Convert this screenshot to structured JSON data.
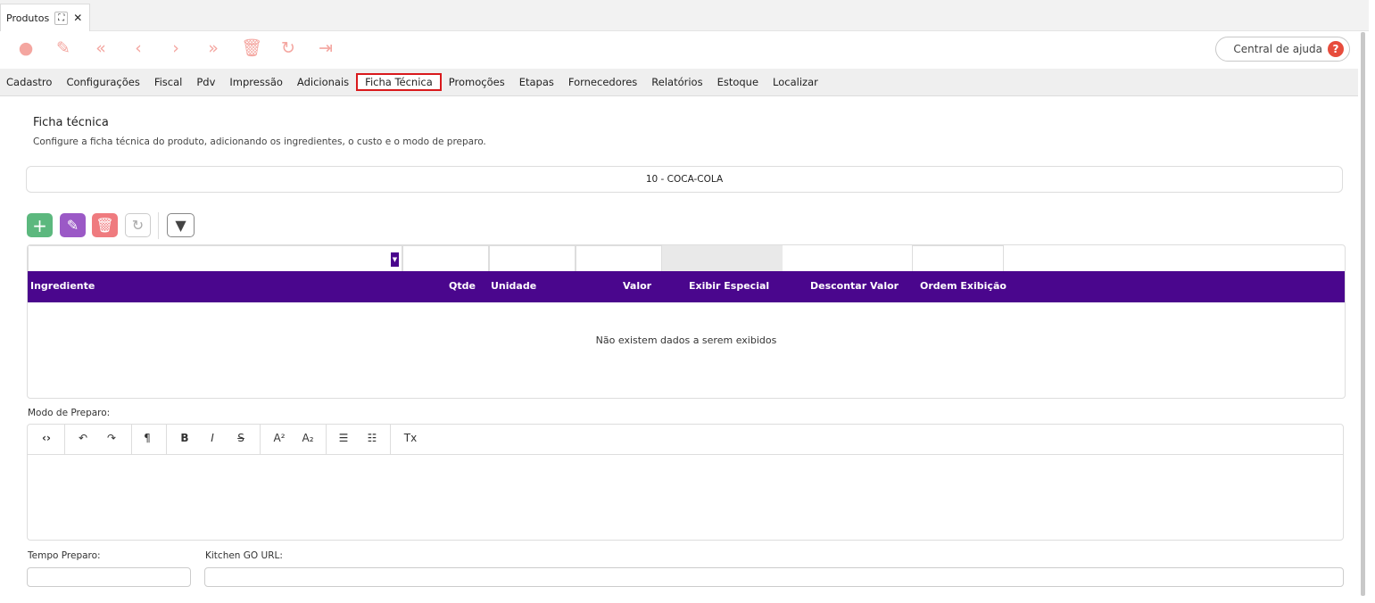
{
  "window_tab": {
    "title": "Produtos",
    "expand_icon": "expand-icon",
    "close_icon": "close-icon"
  },
  "toolbar": {
    "icons": [
      "add-circle-icon",
      "pencil-icon",
      "first-icon",
      "previous-icon",
      "next-icon",
      "last-icon",
      "trash-icon",
      "refresh-icon",
      "exit-icon"
    ],
    "color": "#f4a6a0"
  },
  "help": {
    "label": "Central de ajuda",
    "badge": "?"
  },
  "tabs": [
    "Cadastro",
    "Configurações",
    "Fiscal",
    "Pdv",
    "Impressão",
    "Adicionais",
    "Ficha Técnica",
    "Promoções",
    "Etapas",
    "Fornecedores",
    "Relatórios",
    "Estoque",
    "Localizar"
  ],
  "active_tab": "Ficha Técnica",
  "section": {
    "title": "Ficha técnica",
    "subtitle": "Configure a ficha técnica do produto, adicionando os ingredientes, o custo e o modo de preparo."
  },
  "product": {
    "value": "10 - COCA-COLA"
  },
  "grid": {
    "header_color": "#4a068d",
    "columns": [
      "Ingrediente",
      "Qtde",
      "Unidade",
      "Valor",
      "Exibir Especial",
      "Descontar Valor",
      "Ordem Exibição"
    ],
    "empty_message": "Não existem dados a serem exibidos"
  },
  "preparo": {
    "label": "Modo de Preparo:"
  },
  "tempo": {
    "label": "Tempo Preparo:",
    "value": ""
  },
  "kitchen": {
    "label": "Kitchen GO URL:",
    "value": ""
  }
}
